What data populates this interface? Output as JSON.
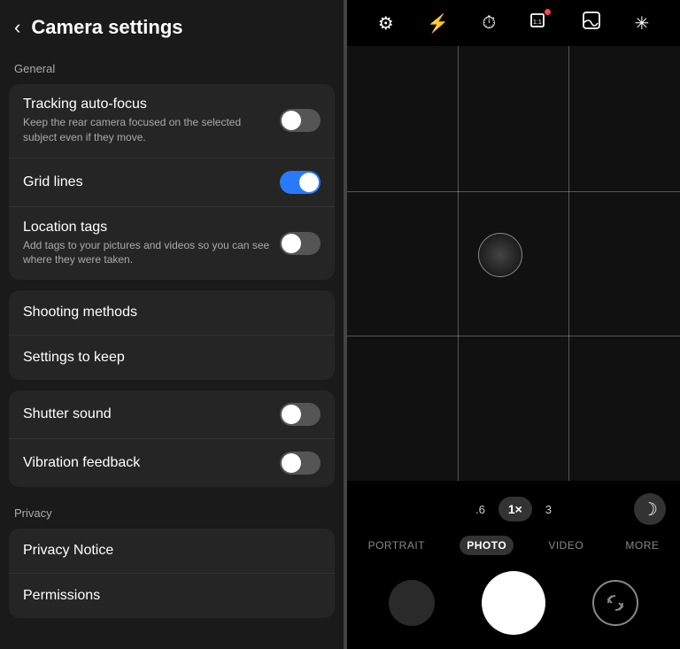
{
  "header": {
    "back_label": "‹",
    "title": "Camera settings"
  },
  "sections": {
    "general": {
      "label": "General",
      "items": [
        {
          "id": "tracking-autofocus",
          "title": "Tracking auto-focus",
          "desc": "Keep the rear camera focused on the selected subject even if they move.",
          "toggle": true,
          "toggle_state": "off"
        },
        {
          "id": "grid-lines",
          "title": "Grid lines",
          "desc": "",
          "toggle": true,
          "toggle_state": "on",
          "has_arrow": true
        },
        {
          "id": "location-tags",
          "title": "Location tags",
          "desc": "Add tags to your pictures and videos so you can see where they were taken.",
          "toggle": true,
          "toggle_state": "off"
        }
      ]
    },
    "navigation": [
      {
        "id": "shooting-methods",
        "title": "Shooting methods"
      },
      {
        "id": "settings-to-keep",
        "title": "Settings to keep"
      }
    ],
    "sound": [
      {
        "id": "shutter-sound",
        "title": "Shutter sound",
        "toggle": true,
        "toggle_state": "off"
      },
      {
        "id": "vibration-feedback",
        "title": "Vibration feedback",
        "toggle": true,
        "toggle_state": "off"
      }
    ],
    "privacy": {
      "label": "Privacy",
      "items": [
        {
          "id": "privacy-notice",
          "title": "Privacy Notice"
        },
        {
          "id": "permissions",
          "title": "Permissions"
        }
      ]
    }
  },
  "camera": {
    "top_icons": [
      {
        "name": "settings-icon",
        "symbol": "⚙"
      },
      {
        "name": "flash-icon",
        "symbol": "⚡"
      },
      {
        "name": "timer-icon",
        "symbol": "◷"
      },
      {
        "name": "ratio-icon",
        "symbol": "▣",
        "badge": true
      },
      {
        "name": "filter-icon",
        "symbol": "⬜"
      },
      {
        "name": "special-icon",
        "symbol": "✳"
      }
    ],
    "zoom_levels": [
      {
        "label": ".6",
        "active": false
      },
      {
        "label": "1×",
        "active": true
      },
      {
        "label": "3",
        "active": false
      }
    ],
    "mode_tabs": [
      {
        "label": "PORTRAIT",
        "active": false
      },
      {
        "label": "PHOTO",
        "active": true
      },
      {
        "label": "VIDEO",
        "active": false
      },
      {
        "label": "MORE",
        "active": false
      }
    ],
    "night_icon": "☽"
  }
}
